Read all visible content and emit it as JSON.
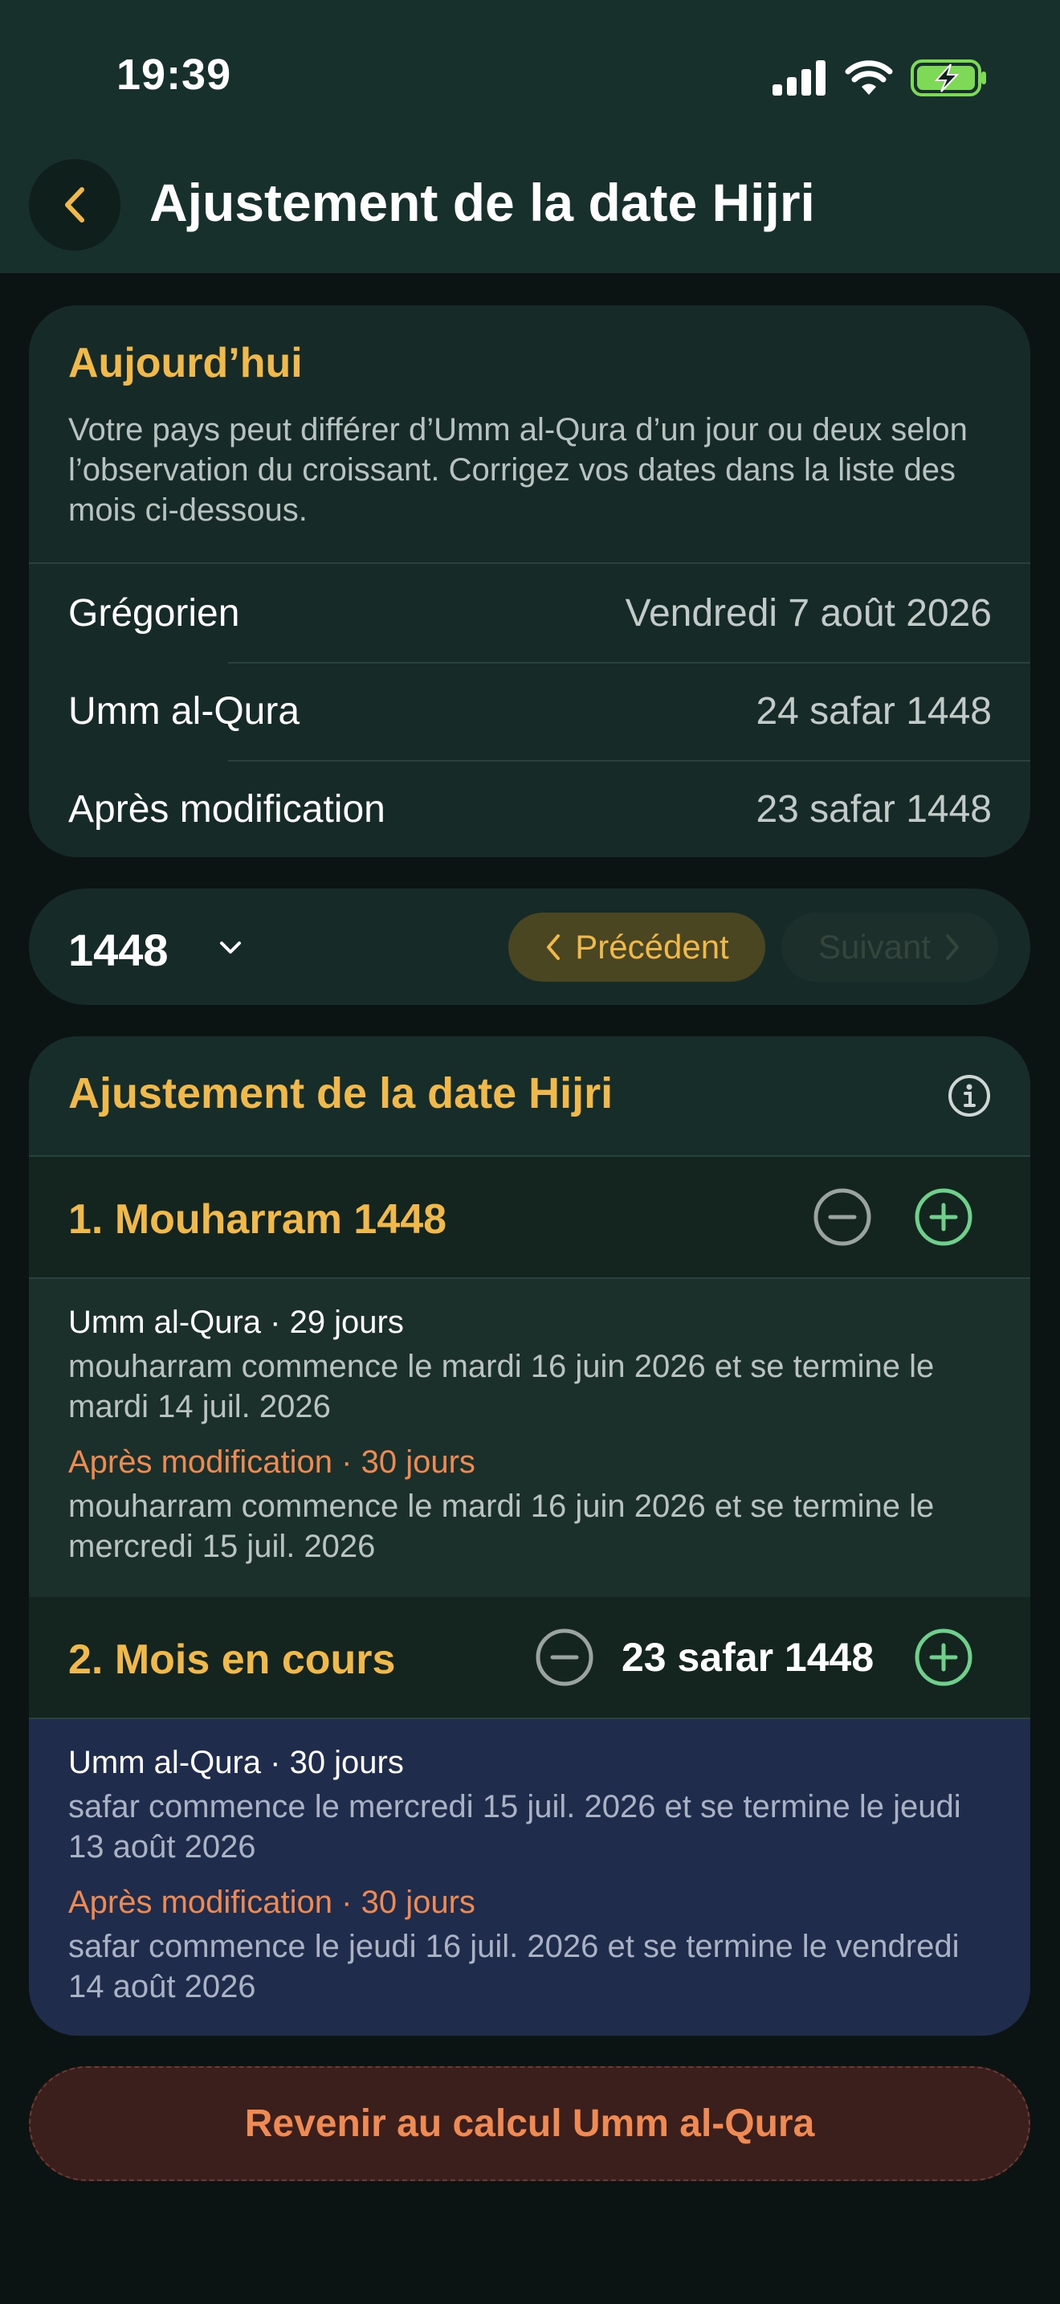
{
  "status_bar": {
    "time": "19:39"
  },
  "header": {
    "title": "Ajustement de la date Hijri"
  },
  "today_card": {
    "title": "Aujourd’hui",
    "description": "Votre pays peut différer d’Umm al-Qura d’un jour ou deux selon l’observation du croissant. Corrigez vos dates dans la liste des mois ci-dessous.",
    "rows": [
      {
        "label": "Grégorien",
        "value": "Vendredi 7 août 2026"
      },
      {
        "label": "Umm al-Qura",
        "value": "24 safar 1448"
      },
      {
        "label": "Après modification",
        "value": "23 safar 1448"
      }
    ]
  },
  "year_selector": {
    "year": "1448",
    "prev_label": "Précédent",
    "next_label": "Suivant"
  },
  "adjustment": {
    "title": "Ajustement de la date Hijri",
    "months": [
      {
        "title": "1. Mouharram 1448",
        "umm_head": "Umm al-Qura · 29 jours",
        "umm_text": "mouharram commence le mardi 16 juin 2026 et se termine le mardi 14 juil. 2026",
        "mod_head": "Après modification · 30 jours",
        "mod_text": "mouharram commence le mardi 16 juin 2026 et se termine le mercredi 15 juil. 2026"
      },
      {
        "title": "2. Mois en cours",
        "current_date": "23 safar 1448",
        "umm_head": "Umm al-Qura · 30 jours",
        "umm_text": "safar commence le mercredi 15 juil. 2026 et se termine le jeudi 13 août 2026",
        "mod_head": "Après modification · 30 jours",
        "mod_text": "safar commence le jeudi 16 juil. 2026 et se termine le vendredi 14 août 2026"
      }
    ]
  },
  "reset_button": {
    "label": "Revenir au calcul Umm al-Qura"
  },
  "colors": {
    "accent": "#f0b94a",
    "modified": "#ee8a52",
    "plus": "#6fd08c",
    "card": "#162b27",
    "highlight": "#1f2c4c"
  }
}
